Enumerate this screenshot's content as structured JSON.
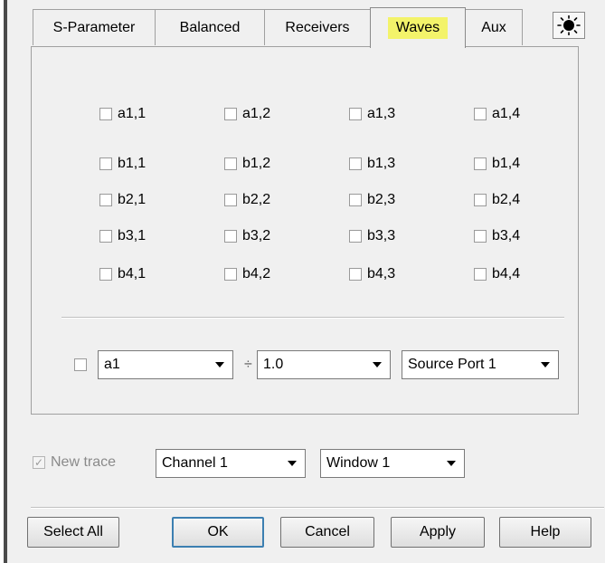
{
  "tabs": [
    {
      "label": "S-Parameter"
    },
    {
      "label": "Balanced"
    },
    {
      "label": "Receivers"
    },
    {
      "label": "Waves",
      "active": true,
      "highlight": "#f3f36a"
    },
    {
      "label": "Aux"
    }
  ],
  "light_icon": "sun-icon",
  "waves": {
    "a_row": [
      "a1,1",
      "a1,2",
      "a1,3",
      "a1,4"
    ],
    "b_rows": [
      [
        "b1,1",
        "b1,2",
        "b1,3",
        "b1,4"
      ],
      [
        "b2,1",
        "b2,2",
        "b2,3",
        "b2,4"
      ],
      [
        "b3,1",
        "b3,2",
        "b3,3",
        "b3,4"
      ],
      [
        "b4,1",
        "b4,2",
        "b4,3",
        "b4,4"
      ]
    ]
  },
  "ratio": {
    "checked": false,
    "numerator": "a1",
    "divide_symbol": "÷",
    "denominator": "1.0",
    "source": "Source Port 1"
  },
  "new_trace": {
    "label": "New trace",
    "checked": true,
    "enabled": false
  },
  "channel": {
    "value": "Channel 1"
  },
  "window": {
    "value": "Window 1"
  },
  "buttons": {
    "select_all": "Select All",
    "ok": "OK",
    "cancel": "Cancel",
    "apply": "Apply",
    "help": "Help"
  }
}
